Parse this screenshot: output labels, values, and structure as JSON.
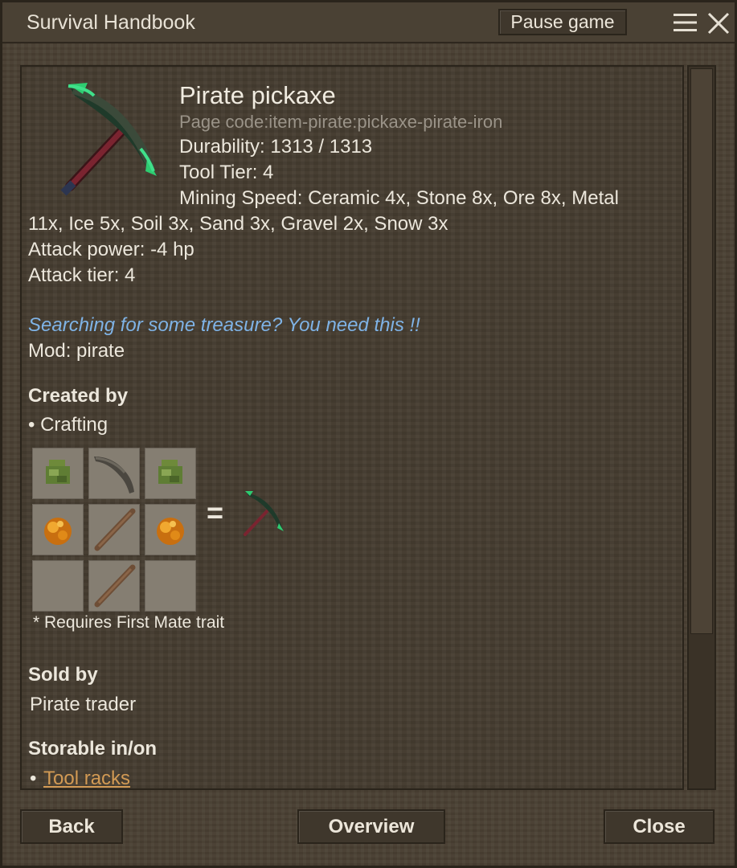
{
  "window": {
    "title": "Survival Handbook",
    "pause_label": "Pause game"
  },
  "item": {
    "name": "Pirate pickaxe",
    "page_code": "Page code:item-pirate:pickaxe-pirate-iron",
    "durability": "Durability: 1313 / 1313",
    "tool_tier": "Tool Tier: 4",
    "mining_speed_line1": "Mining Speed: Ceramic 4x, Stone 8x, Ore 8x, Metal",
    "mining_speed_line2": "11x, Ice 5x, Soil 3x, Sand 3x, Gravel 2x, Snow 3x",
    "attack_power": "Attack power: -4 hp",
    "attack_tier": "Attack tier: 4",
    "flavor": "Searching for some treasure? You need this !!",
    "mod": "Mod: pirate",
    "icon": "pickaxe-icon"
  },
  "created_by": {
    "heading": "Created by",
    "method": "• Crafting",
    "grid": [
      [
        "green-resin-icon",
        "pickaxe-head-icon",
        "green-resin-icon"
      ],
      [
        "amber-ore-icon",
        "stick-icon",
        "amber-ore-icon"
      ],
      [
        "empty",
        "stick-icon",
        "empty"
      ]
    ],
    "equals": "=",
    "result_icon": "pickaxe-icon",
    "note": "* Requires First Mate trait"
  },
  "sold_by": {
    "heading": "Sold by",
    "value": "Pirate trader"
  },
  "storable": {
    "heading": "Storable in/on",
    "bullet": "•",
    "link": "Tool racks"
  },
  "footer": {
    "back_label": "Back",
    "overview_label": "Overview",
    "close_label": "Close"
  },
  "colors": {
    "flavor_text": "#7fb3e6",
    "link": "#d29a54",
    "page_code": "#9a9388"
  }
}
